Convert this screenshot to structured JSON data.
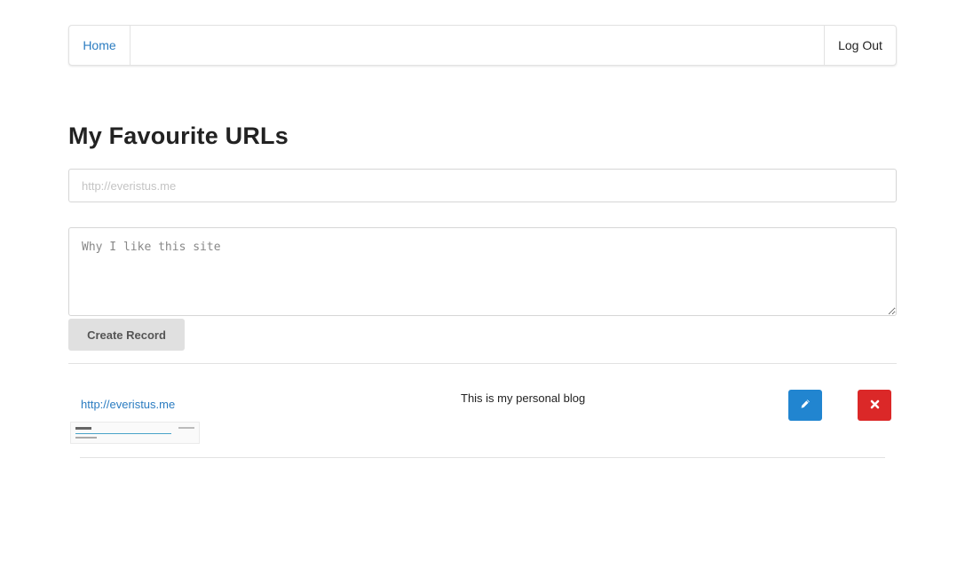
{
  "nav": {
    "home_label": "Home",
    "logout_label": "Log Out"
  },
  "page": {
    "title": "My Favourite URLs"
  },
  "form": {
    "url_placeholder": "http://everistus.me",
    "url_value": "",
    "reason_placeholder": "Why I like this site",
    "reason_value": "",
    "create_label": "Create Record"
  },
  "records": [
    {
      "url": "http://everistus.me",
      "description": "This is my personal blog",
      "edit_icon": "pencil-icon",
      "delete_icon": "close-icon"
    }
  ],
  "colors": {
    "link": "#2b7cc1",
    "edit_button": "#2185d0",
    "delete_button": "#db2828",
    "create_button": "#e0e0e0"
  }
}
